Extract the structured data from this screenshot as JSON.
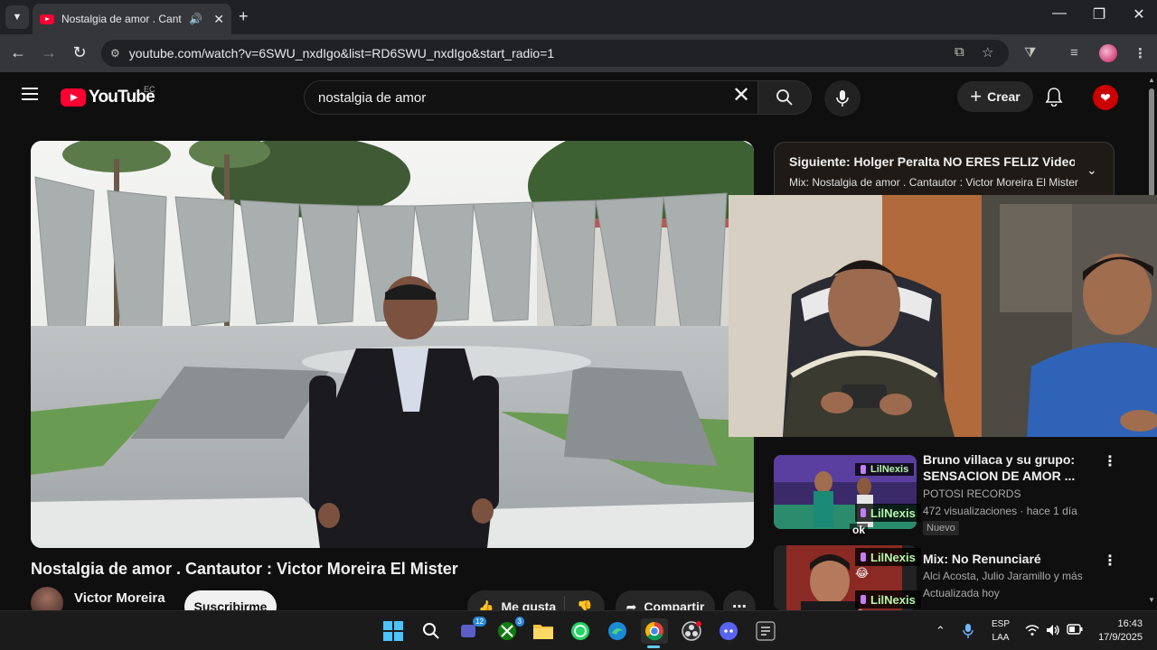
{
  "browser": {
    "tab_title": "Nostalgia de amor . Cantautor : Victor Moreira El Mister",
    "url": "youtube.com/watch?v=6SWU_nxdIgo&list=RD6SWU_nxdIgo&start_radio=1"
  },
  "youtube": {
    "logo_text": "YouTube",
    "country": "EC",
    "search_query": "nostalgia de amor",
    "create_label": "Crear"
  },
  "video": {
    "title": "Nostalgia de amor . Cantautor : Victor Moreira El Mister",
    "channel": "Victor Moreira",
    "subscribe_label": "Suscribirme",
    "like_label": "Me gusta",
    "share_label": "Compartir"
  },
  "up_next": {
    "title": "Siguiente: Holger Peralta NO ERES FELIZ Video ofic...",
    "subtitle": "Mix: Nostalgia de amor . Cantautor : Victor Moreira El Mister"
  },
  "recommendations": [
    {
      "title_line1": "Bruno villaca y su grupo:",
      "title_line2": "SENSACION DE AMOR ...",
      "channel": "POTOSI RECORDS",
      "meta": "472 visualizaciones · hace 1 día",
      "badge": "Nuevo"
    },
    {
      "title_line1": "Mix: No Renunciaré",
      "channel": "Alci Acosta, Julio Jaramillo y más",
      "meta": "Actualizada hoy"
    }
  ],
  "chat": {
    "username": "LilNexis",
    "message": "ok"
  },
  "taskbar": {
    "teams_badge": "12",
    "xbox_badge": "3",
    "lang_line1": "ESP",
    "lang_line2": "LAA",
    "time": "16:43",
    "date": "17/9/2025"
  },
  "colors": {
    "youtube_red": "#ff0033",
    "background": "#0f0f0f",
    "chat_name": "#b6f5a8"
  }
}
